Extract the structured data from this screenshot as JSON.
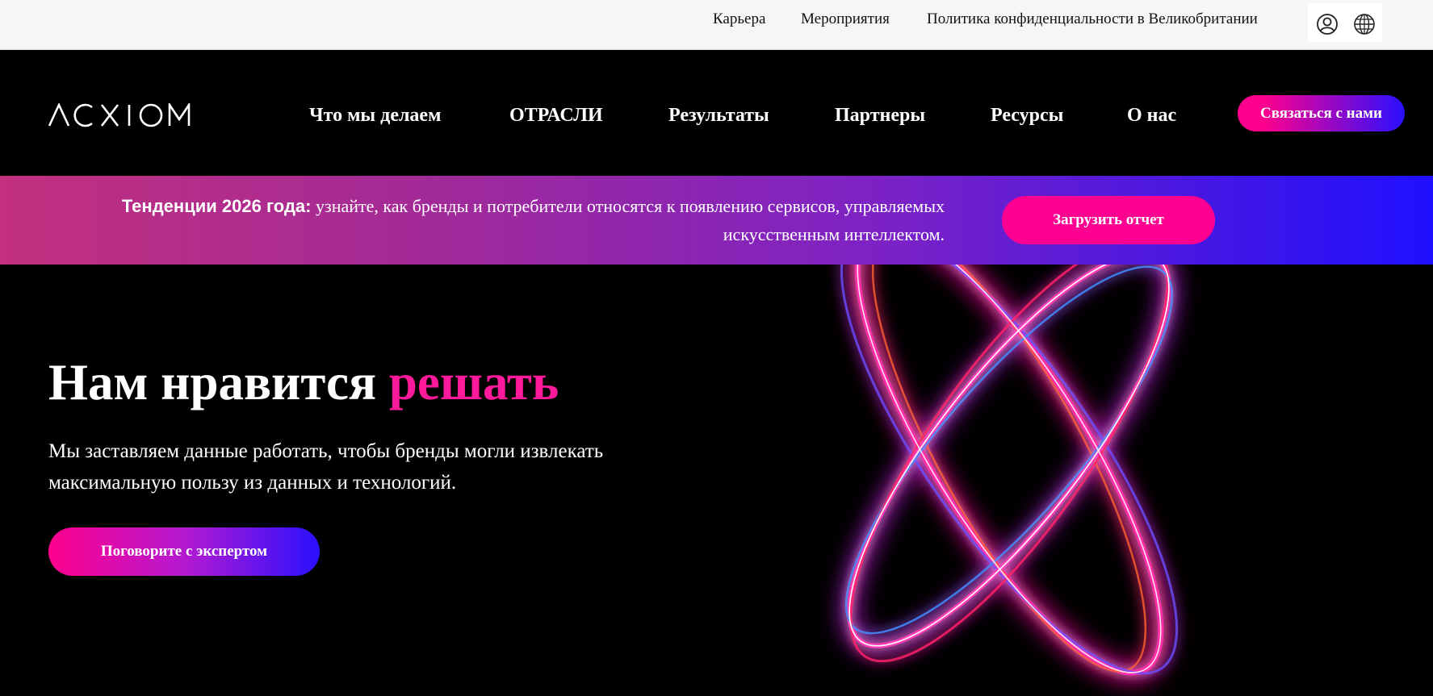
{
  "topbar": {
    "links": [
      "Карьера",
      "Мероприятия",
      "Политика конфиденциальности в Великобритании"
    ],
    "icons": [
      "user-icon",
      "globe-icon"
    ]
  },
  "header": {
    "logo_text": "ACXIOM",
    "nav": [
      "Что мы делаем",
      "ОТРАСЛИ",
      "Результаты",
      "Партнеры",
      "Ресурсы",
      "О нас"
    ],
    "contact_label": "Связаться с нами"
  },
  "banner": {
    "bold": "Тенденции 2026 года:",
    "text": " узнайте, как бренды и потребители относятся к появлению сервисов, управляемых искусственным интеллектом.",
    "button": "Загрузить отчет"
  },
  "hero": {
    "title_main": "Нам нравится ",
    "title_accent": "решать",
    "subtitle": "Мы заставляем данные работать, чтобы бренды могли извлекать максимальную пользу из данных и технологий.",
    "cta": "Поговорите с экспертом"
  },
  "colors": {
    "accent": "#ff1a9c",
    "button_pink": "#ff0090",
    "gradient_blue": "#1f10ff",
    "background": "#000000"
  }
}
